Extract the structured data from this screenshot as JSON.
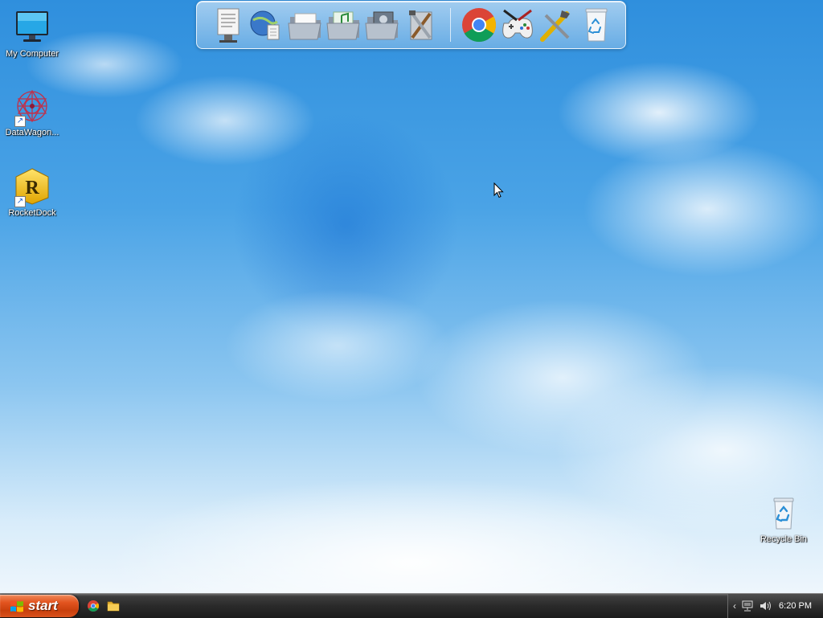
{
  "desktop": {
    "icons": [
      {
        "label": "My Computer",
        "icon": "monitor-icon"
      },
      {
        "label": "DataWagon...",
        "icon": "datawagon-icon"
      },
      {
        "label": "RocketDock",
        "icon": "rocketdock-icon"
      },
      {
        "label": "Recycle Bin",
        "icon": "recycle-bin-icon"
      }
    ]
  },
  "dock": {
    "items": [
      {
        "icon": "text-document-icon"
      },
      {
        "icon": "network-globe-icon"
      },
      {
        "icon": "documents-folder-icon"
      },
      {
        "icon": "music-folder-icon"
      },
      {
        "icon": "pictures-folder-icon"
      },
      {
        "icon": "tools-icon"
      },
      {
        "icon": "chrome-icon"
      },
      {
        "icon": "gamepad-icon"
      },
      {
        "icon": "settings-tools-icon"
      },
      {
        "icon": "recycle-bin-icon"
      }
    ]
  },
  "taskbar": {
    "start_label": "start",
    "quick_launch": [
      {
        "icon": "chrome-icon"
      },
      {
        "icon": "folder-icon"
      }
    ],
    "tray": {
      "chevron": "‹",
      "icons": [
        "network-icon",
        "volume-icon"
      ],
      "clock": "6:20 PM"
    }
  },
  "colors": {
    "sky_top": "#2f8fdd",
    "taskbar": "#2a2a2a",
    "start_button": "#e2541f"
  }
}
